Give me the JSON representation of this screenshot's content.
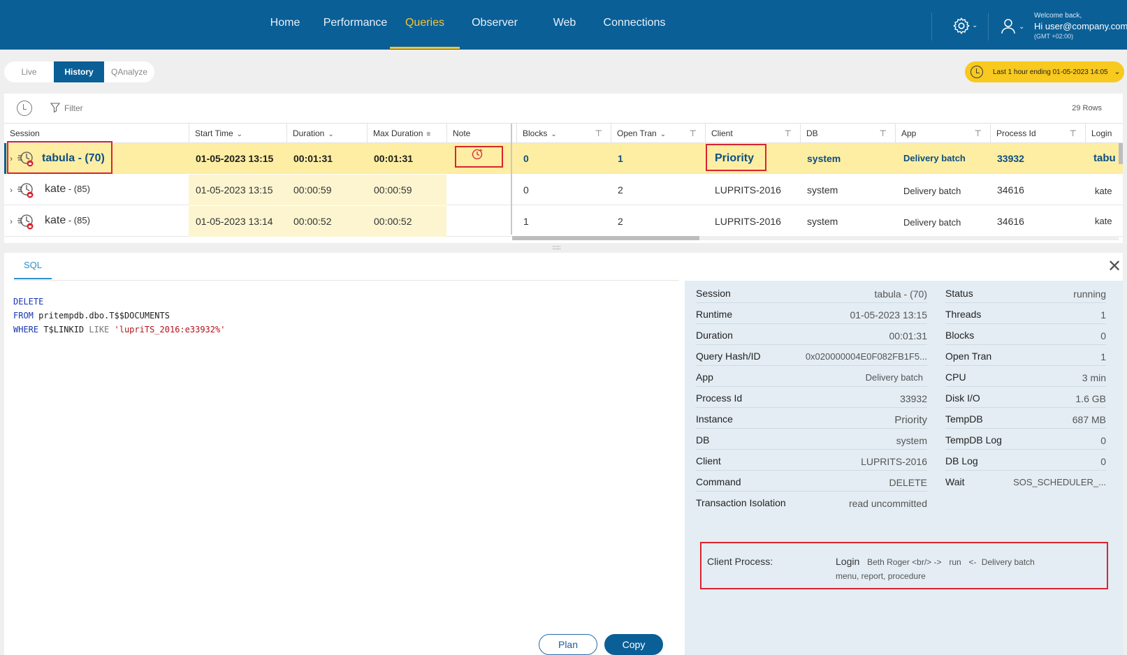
{
  "nav": {
    "items": [
      "Home",
      "Performance",
      "Queries",
      "Observer",
      "Web",
      "Connections"
    ],
    "active": "Queries"
  },
  "user": {
    "welcome": "Welcome back,",
    "greeting": "Hi user@company.com",
    "timezone": "(GMT +02:00)"
  },
  "modes": {
    "live": "Live",
    "history": "History",
    "qanalyze": "QAnalyze",
    "active": "History"
  },
  "time_range": "Last 1 hour ending  01-05-2023 14:05",
  "toolbar": {
    "filter_label": "Filter",
    "rows_count": "29 Rows"
  },
  "columns": {
    "session": "Session",
    "start_time": "Start Time",
    "duration": "Duration",
    "max_duration": "Max Duration",
    "note": "Note",
    "blocks": "Blocks",
    "open_tran": "Open Tran",
    "client": "Client",
    "db": "DB",
    "app": "App",
    "process_id": "Process Id",
    "login": "Login"
  },
  "rows": [
    {
      "session_name": "tabula - (70)",
      "session_id": "",
      "start_time": "01-05-2023 13:15",
      "duration": "00:01:31",
      "max_duration": "00:01:31",
      "blocks": "0",
      "open_tran": "1",
      "client": "Priority",
      "db": "system",
      "app": "Delivery batch",
      "process_id": "33932",
      "login": "tabu"
    },
    {
      "session_name": "kate",
      "session_id": " - (85)",
      "start_time": "01-05-2023 13:15",
      "duration": "00:00:59",
      "max_duration": "00:00:59",
      "blocks": "0",
      "open_tran": "2",
      "client": "LUPRITS-2016",
      "db": "system",
      "app": "Delivery batch",
      "process_id": "34616",
      "login": "kate"
    },
    {
      "session_name": "kate",
      "session_id": " - (85)",
      "start_time": "01-05-2023 13:14",
      "duration": "00:00:52",
      "max_duration": "00:00:52",
      "blocks": "1",
      "open_tran": "2",
      "client": "LUPRITS-2016",
      "db": "system",
      "app": "Delivery batch",
      "process_id": "34616",
      "login": "kate"
    }
  ],
  "detail": {
    "tab": "SQL",
    "sql": {
      "l1_kw": "DELETE",
      "l2_kw": "FROM",
      "l2_rest": " pritempdb.dbo.T$$DOCUMENTS",
      "l3_kw": "WHERE",
      "l3_mid": " T$LINKID ",
      "l3_op": "LIKE",
      "l3_str": " 'lupriTS_2016:e33932%'"
    },
    "buttons": {
      "plan": "Plan",
      "copy": "Copy"
    },
    "left_props": [
      {
        "k": "Session",
        "v": "tabula - (70)"
      },
      {
        "k": "Runtime",
        "v": "01-05-2023 13:15"
      },
      {
        "k": "Duration",
        "v": "00:01:31"
      },
      {
        "k": "Query Hash/ID",
        "v": "0x020000004E0F082FB1F5..."
      },
      {
        "k": "App",
        "v": "Delivery batch"
      },
      {
        "k": "Process Id",
        "v": "33932"
      },
      {
        "k": "Instance",
        "v": "Priority"
      },
      {
        "k": "DB",
        "v": "system"
      },
      {
        "k": "Client",
        "v": "LUPRITS-2016"
      },
      {
        "k": "Command",
        "v": "DELETE"
      },
      {
        "k": "Transaction Isolation",
        "v": "read uncommitted"
      }
    ],
    "right_props": [
      {
        "k": "Status",
        "v": "running"
      },
      {
        "k": "Threads",
        "v": "1"
      },
      {
        "k": "Blocks",
        "v": "0"
      },
      {
        "k": "Open Tran",
        "v": "1"
      },
      {
        "k": "CPU",
        "v": "3 min"
      },
      {
        "k": "Disk I/O",
        "v": "1.6 GB"
      },
      {
        "k": "TempDB",
        "v": "687 MB"
      },
      {
        "k": "TempDB Log",
        "v": "0"
      },
      {
        "k": "DB Log",
        "v": "0"
      },
      {
        "k": "Wait",
        "v": "SOS_SCHEDULER_..."
      }
    ],
    "client_process": {
      "label": "Client Process:",
      "login_word": "Login",
      "user": "Beth Roger <br/> ->",
      "run": "run",
      "arrow": "<-",
      "app": "Delivery batch",
      "line2": "menu, report, procedure"
    }
  },
  "colors": {
    "brand": "#0a5f97",
    "accent": "#f7c531",
    "selected_row": "#fdeea3",
    "highlight_box": "#d9242f"
  }
}
